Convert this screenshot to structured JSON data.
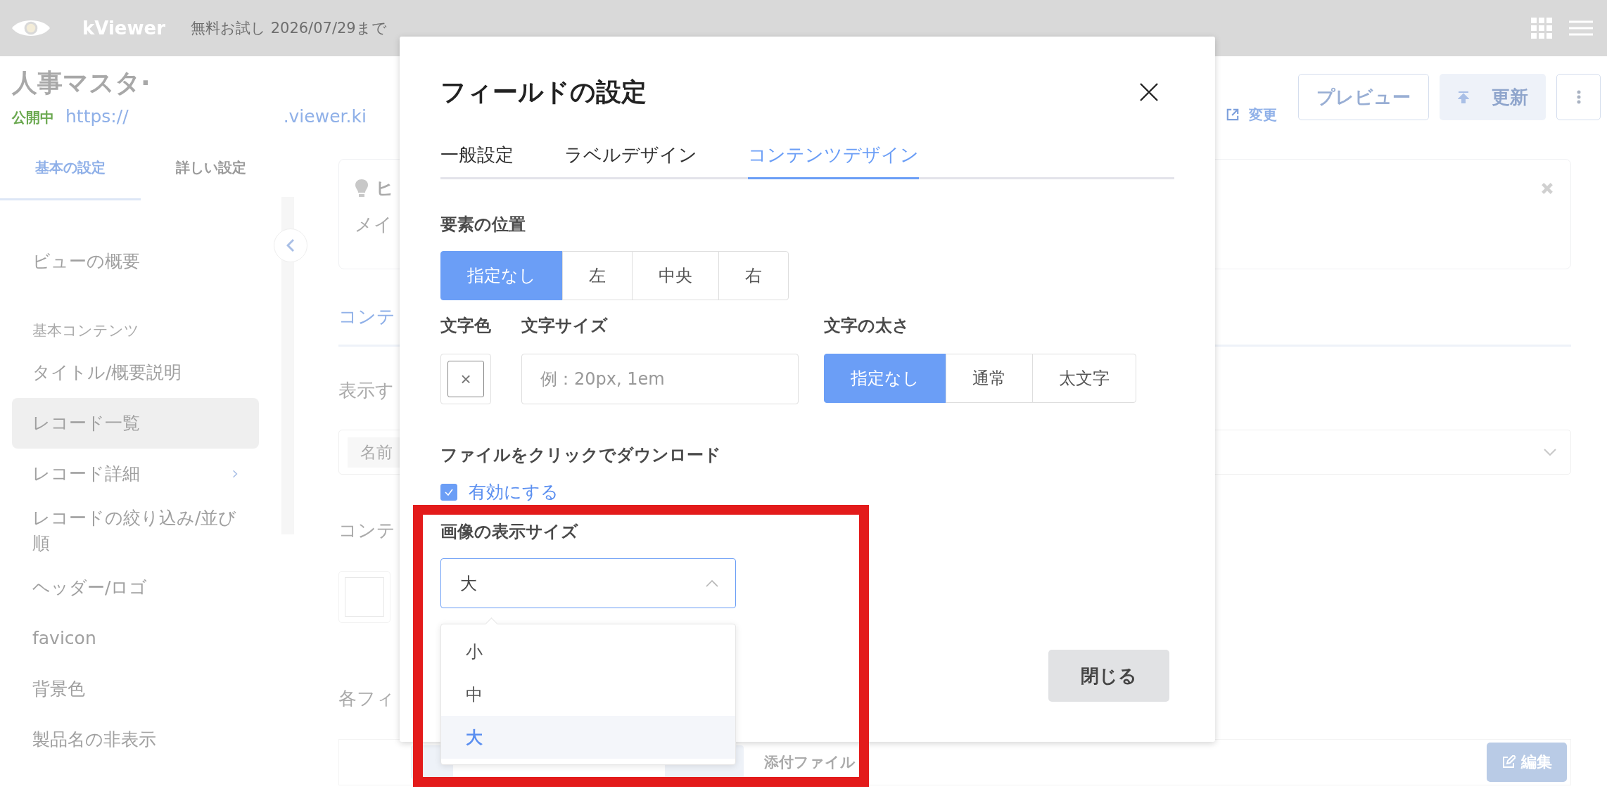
{
  "header": {
    "app_name": "kViewer",
    "trial_notice": "無料お試し 2026/07/29まで"
  },
  "page": {
    "title": "人事マスタ·",
    "status": "公開中",
    "url_start": "https://",
    "url_end": ".viewer.ki",
    "change_link": "変更",
    "preview_button": "プレビュー",
    "update_button": "更新"
  },
  "sidebar": {
    "tabs": [
      {
        "label": "基本の設定",
        "selected": true
      },
      {
        "label": "詳しい設定",
        "selected": false
      }
    ],
    "items": [
      {
        "kind": "item",
        "label": "ビューの概要",
        "selected": false,
        "has_submenu": false
      },
      {
        "kind": "heading",
        "label": "基本コンテンツ"
      },
      {
        "kind": "item",
        "label": "タイトル/概要説明",
        "selected": false,
        "has_submenu": false
      },
      {
        "kind": "item",
        "label": "レコード一覧",
        "selected": true,
        "has_submenu": false
      },
      {
        "kind": "item",
        "label": "レコード詳細",
        "selected": false,
        "has_submenu": true
      },
      {
        "kind": "item",
        "label": "レコードの絞り込み/並び順",
        "selected": false,
        "has_submenu": false
      },
      {
        "kind": "item",
        "label": "ヘッダー/ロゴ",
        "selected": false,
        "has_submenu": false
      },
      {
        "kind": "item",
        "label": "favicon",
        "selected": false,
        "has_submenu": false
      },
      {
        "kind": "item",
        "label": "背景色",
        "selected": false,
        "has_submenu": false
      },
      {
        "kind": "item",
        "label": "製品名の非表示",
        "selected": false,
        "has_submenu": false
      }
    ]
  },
  "content": {
    "hint_title": "ヒ",
    "hint_text": "メイ",
    "tab": "コンテ",
    "label_1": "表示す",
    "select_chip": "名前",
    "label_2": "コンテ",
    "label_3": "各フィ",
    "field_name": "添付ファイル",
    "edit_button": "編集"
  },
  "dialog": {
    "title": "フィールドの設定",
    "tabs": [
      {
        "label": "一般設定",
        "selected": false
      },
      {
        "label": "ラベルデザイン",
        "selected": false
      },
      {
        "label": "コンテンツデザイン",
        "selected": true
      }
    ],
    "position": {
      "label": "要素の位置",
      "options": [
        {
          "label": "指定なし",
          "selected": true
        },
        {
          "label": "左",
          "selected": false
        },
        {
          "label": "中央",
          "selected": false
        },
        {
          "label": "右",
          "selected": false
        }
      ]
    },
    "text_color": {
      "label": "文字色",
      "button_glyph": "×"
    },
    "text_size": {
      "label": "文字サイズ",
      "placeholder": "例：20px, 1em"
    },
    "font_weight": {
      "label": "文字の太さ",
      "options": [
        {
          "label": "指定なし",
          "selected": true
        },
        {
          "label": "通常",
          "selected": false
        },
        {
          "label": "太文字",
          "selected": false
        }
      ]
    },
    "download": {
      "label": "ファイルをクリックでダウンロード",
      "checkbox_label": "有効にする",
      "checked": true
    },
    "image_size": {
      "label": "画像の表示サイズ",
      "value": "大",
      "expanded": true,
      "options": [
        {
          "label": "小",
          "selected": false
        },
        {
          "label": "中",
          "selected": false
        },
        {
          "label": "大",
          "selected": true
        }
      ]
    },
    "close_button": "閉じる"
  }
}
